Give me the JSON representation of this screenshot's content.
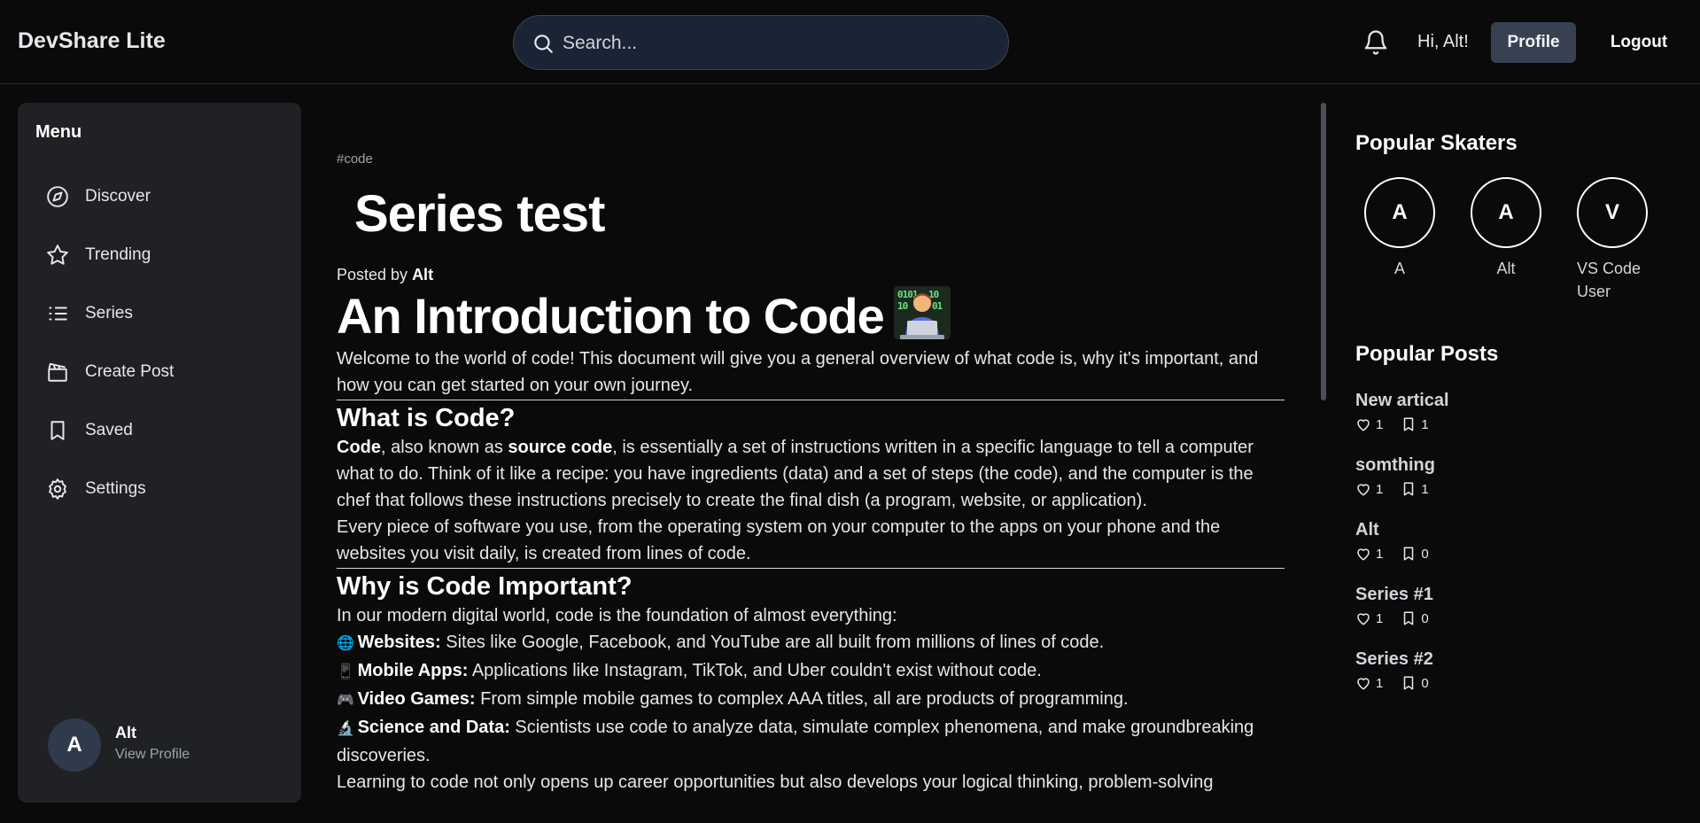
{
  "header": {
    "brand": "DevShare Lite",
    "search_placeholder": "Search...",
    "greeting": "Hi, Alt!",
    "profile_label": "Profile",
    "logout_label": "Logout"
  },
  "sidebar": {
    "menu_title": "Menu",
    "items": [
      {
        "label": "Discover",
        "icon": "compass-icon"
      },
      {
        "label": "Trending",
        "icon": "star-icon"
      },
      {
        "label": "Series",
        "icon": "list-icon"
      },
      {
        "label": "Create Post",
        "icon": "clapper-icon"
      },
      {
        "label": "Saved",
        "icon": "bookmark-icon"
      },
      {
        "label": "Settings",
        "icon": "gear-icon"
      }
    ],
    "user": {
      "initial": "A",
      "name": "Alt",
      "link": "View Profile"
    }
  },
  "main": {
    "tag": "#code",
    "series_title": "Series test",
    "posted_prefix": "Posted by ",
    "author": "Alt",
    "article": {
      "h1": "An Introduction to Code",
      "intro": "Welcome to the world of code! This document will give you a general overview of what code is, why it's important, and how you can get started on your own journey.",
      "h2_what": "What is Code?",
      "what_b1": "Code",
      "what_t1": ", also known as ",
      "what_b2": "source code",
      "what_t2": ", is essentially a set of instructions written in a specific language to tell a computer what to do. Think of it like a recipe: you have ingredients (data) and a set of steps (the code), and the computer is the chef that follows these instructions precisely to create the final dish (a program, website, or application).",
      "what_p2": "Every piece of software you use, from the operating system on your computer to the apps on your phone and the websites you visit daily, is created from lines of code.",
      "h2_why": "Why is Code Important?",
      "why_intro": "In our modern digital world, code is the foundation of almost everything:",
      "bullets": [
        {
          "icon": "🌐",
          "bold": "Websites:",
          "text": " Sites like Google, Facebook, and YouTube are all built from millions of lines of code."
        },
        {
          "icon": "📱",
          "bold": "Mobile Apps:",
          "text": " Applications like Instagram, TikTok, and Uber couldn't exist without code."
        },
        {
          "icon": "🎮",
          "bold": "Video Games:",
          "text": " From simple mobile games to complex AAA titles, all are products of programming."
        },
        {
          "icon": "🔬",
          "bold": "Science and Data:",
          "text": " Scientists use code to analyze data, simulate complex phenomena, and make groundbreaking discoveries."
        }
      ],
      "closing": "Learning to code not only opens up career opportunities but also develops your logical thinking, problem-solving"
    }
  },
  "right": {
    "skaters_title": "Popular Skaters",
    "skaters": [
      {
        "initial": "A",
        "name": "A"
      },
      {
        "initial": "A",
        "name": "Alt"
      },
      {
        "initial": "V",
        "name": "VS Code User"
      }
    ],
    "posts_title": "Popular Posts",
    "posts": [
      {
        "title": "New artical",
        "likes": "1",
        "saves": "1"
      },
      {
        "title": "somthing",
        "likes": "1",
        "saves": "1"
      },
      {
        "title": "Alt",
        "likes": "1",
        "saves": "0"
      },
      {
        "title": "Series #1",
        "likes": "1",
        "saves": "0"
      },
      {
        "title": "Series #2",
        "likes": "1",
        "saves": "0"
      }
    ]
  }
}
